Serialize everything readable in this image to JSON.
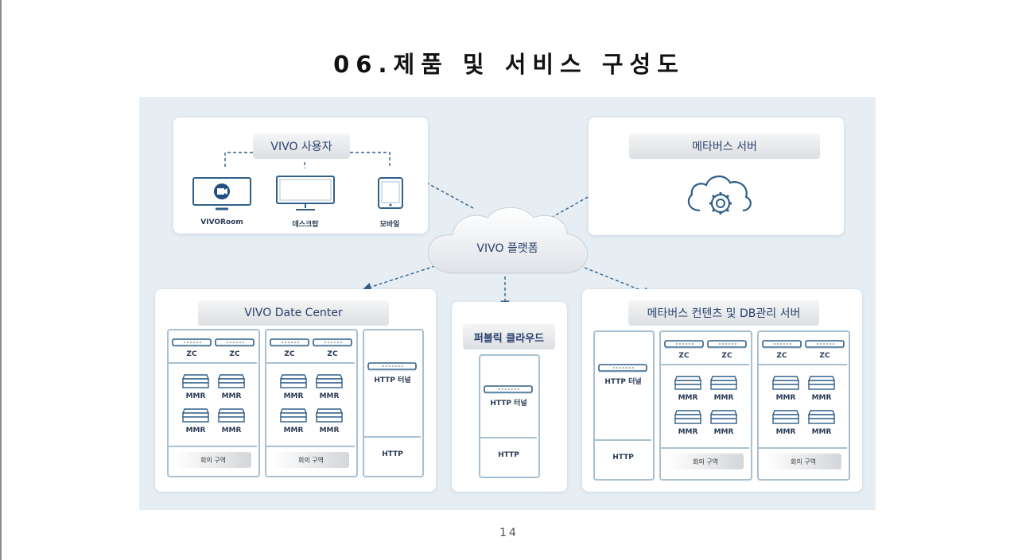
{
  "page": {
    "title": "06.제품 및 서비스 구성도",
    "page_number": "14"
  },
  "diagram": {
    "users": {
      "title": "VIVO 사용자",
      "devices": [
        "VIVORoom",
        "데스크탑",
        "모바일"
      ]
    },
    "metaverse_server": {
      "title": "메타버스 서버"
    },
    "platform": {
      "label": "VIVO 플랫폼"
    },
    "data_center": {
      "title": "VIVO Date Center",
      "zc": "ZC",
      "mmr": "MMR",
      "meeting_zone": "회의 구역",
      "http_tunnel": "HTTP 터널",
      "http": "HTTP"
    },
    "public_cloud": {
      "title": "퍼블릭 클라우드",
      "http_tunnel": "HTTP 터널",
      "http": "HTTP"
    },
    "contents_server": {
      "title": "메타버스 컨텐츠 및 DB관리 서버",
      "zc": "ZC",
      "mmr": "MMR",
      "meeting_zone": "회의 구역",
      "http_tunnel": "HTTP 터널",
      "http": "HTTP"
    },
    "colors": {
      "background": "#e6eef4",
      "panel": "#ffffff",
      "line": "#2f5f8a",
      "box_border": "#a8c0d2",
      "title_text": "#2a3f6e"
    },
    "icons": [
      "video-camera-icon",
      "monitor-icon",
      "tablet-icon",
      "cloud-gear-icon",
      "cloud-icon",
      "server-unit-icon",
      "server-stack-icon"
    ]
  }
}
